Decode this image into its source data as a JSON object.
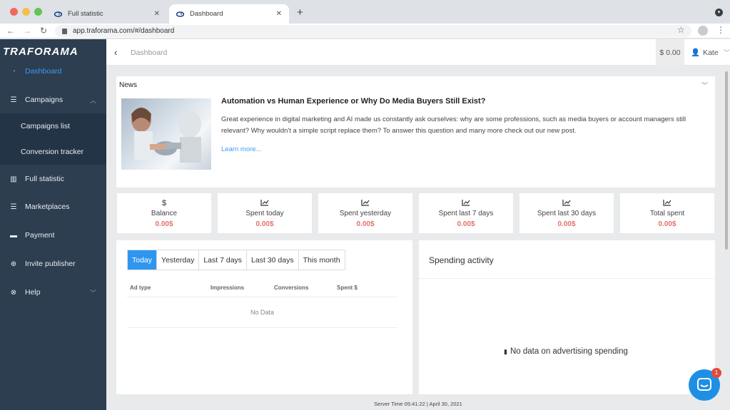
{
  "browser": {
    "tabs": [
      {
        "title": "Full statistic"
      },
      {
        "title": "Dashboard"
      }
    ],
    "url": "app.traforama.com/#/dashboard"
  },
  "sidebar": {
    "logo": "TRAFORAMA",
    "items": [
      {
        "label": "Dashboard",
        "icon": "gauge-icon"
      },
      {
        "label": "Campaigns",
        "icon": "sliders-icon"
      },
      {
        "label": "Campaigns list"
      },
      {
        "label": "Conversion tracker"
      },
      {
        "label": "Full statistic",
        "icon": "bar-chart-icon"
      },
      {
        "label": "Marketplaces",
        "icon": "sliders-icon"
      },
      {
        "label": "Payment",
        "icon": "card-icon"
      },
      {
        "label": "Invite publisher",
        "icon": "plus-circle-icon"
      },
      {
        "label": "Help",
        "icon": "close-circle-icon"
      }
    ]
  },
  "header": {
    "breadcrumb": "Dashboard",
    "balance": "$ 0.00",
    "user": "Kate"
  },
  "news": {
    "label": "News",
    "title": "Automation vs Human Experience or Why Do Media Buyers Still Exist?",
    "body": "Great experience in digital marketing and AI made us constantly ask ourselves: why are some professions, such as media buyers or account managers still relevant? Why wouldn't a simple script replace them? To answer this question and many more check out our new post.",
    "link": "Learn more..."
  },
  "stats": [
    {
      "icon": "$",
      "label": "Balance",
      "value": "0.00$"
    },
    {
      "icon": "trend-icon",
      "label": "Spent today",
      "value": "0.00$"
    },
    {
      "icon": "trend-icon",
      "label": "Spent yesterday",
      "value": "0.00$"
    },
    {
      "icon": "trend-icon",
      "label": "Spent last 7 days",
      "value": "0.00$"
    },
    {
      "icon": "trend-icon",
      "label": "Spent last 30 days",
      "value": "0.00$"
    },
    {
      "icon": "trend-icon",
      "label": "Total spent",
      "value": "0.00$"
    }
  ],
  "periods": [
    "Today",
    "Yesterday",
    "Last 7 days",
    "Last 30 days",
    "This month"
  ],
  "table": {
    "headers": [
      "Ad type",
      "Impressions",
      "Conversions",
      "Spent $"
    ],
    "empty": "No Data"
  },
  "spending": {
    "title": "Spending activity",
    "empty": "No data on advertising spending"
  },
  "footer": "Server Time 05:41:22 | April 30, 2021",
  "chat": {
    "badge": "1"
  },
  "colors": {
    "sidebar": "#2c3e50",
    "accent": "#2f96f0",
    "value": "#e5706c"
  }
}
